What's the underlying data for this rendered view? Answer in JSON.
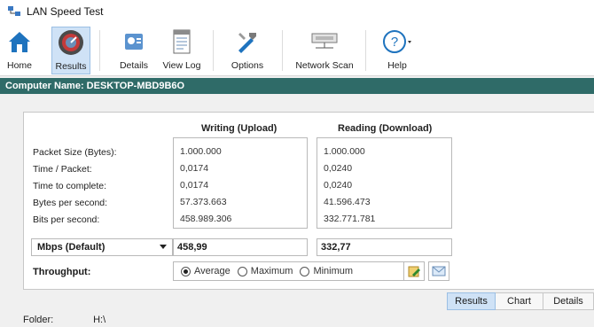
{
  "window": {
    "title": "LAN Speed Test"
  },
  "toolbar": {
    "buttons": [
      {
        "label": "Home",
        "icon": "home-icon"
      },
      {
        "label": "Results",
        "icon": "speedometer-icon",
        "active": true
      },
      {
        "label": "Details",
        "icon": "details-icon"
      },
      {
        "label": "View Log",
        "icon": "log-icon"
      },
      {
        "label": "Options",
        "icon": "tools-icon"
      },
      {
        "label": "Network Scan",
        "icon": "network-scan-icon"
      },
      {
        "label": "Help",
        "icon": "help-icon"
      }
    ]
  },
  "computer_bar": {
    "text": "Computer Name: DESKTOP-MBD9B6O"
  },
  "results": {
    "writing_header": "Writing (Upload)",
    "reading_header": "Reading (Download)",
    "row_labels": [
      "Packet Size (Bytes):",
      "Time / Packet:",
      "Time to complete:",
      "Bytes per second:",
      "Bits per second:"
    ],
    "writing_values": [
      "1.000.000",
      "0,0174",
      "0,0174",
      "57.373.663",
      "458.989.306"
    ],
    "reading_values": [
      "1.000.000",
      "0,0240",
      "0,0240",
      "41.596.473",
      "332.771.781"
    ],
    "unit_select": "Mbps (Default)",
    "writing_result": "458,99",
    "reading_result": "332,77",
    "throughput_label": "Throughput:",
    "radio_options": [
      "Average",
      "Maximum",
      "Minimum"
    ],
    "selected_radio": "Average"
  },
  "tabs": [
    "Results",
    "Chart",
    "Details"
  ],
  "active_tab": "Results",
  "folder": {
    "label": "Folder:",
    "value": "H:\\"
  },
  "colors": {
    "accent_bar": "#2f6b68",
    "active_highlight": "#cfe2f6"
  }
}
